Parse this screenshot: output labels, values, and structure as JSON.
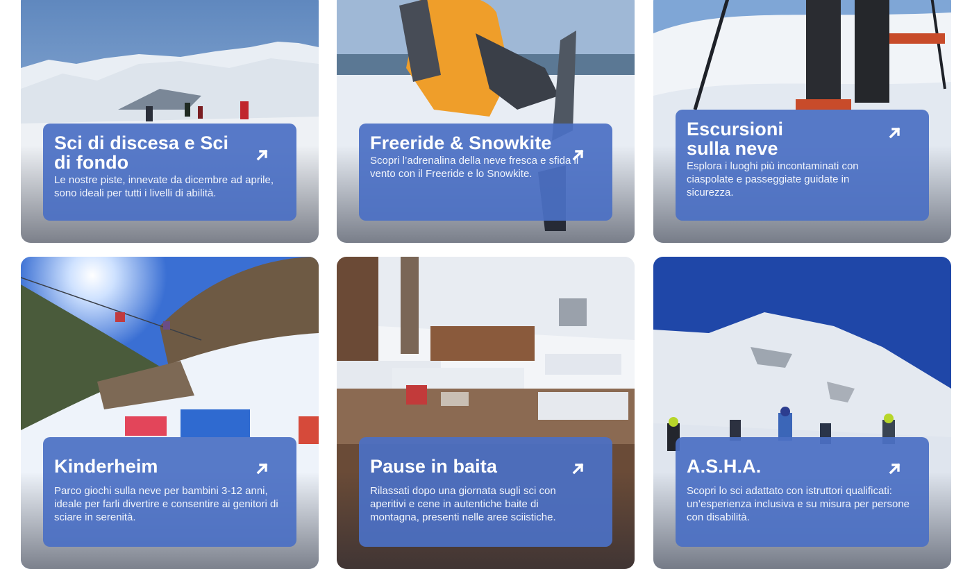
{
  "cards": [
    {
      "title": "Sci di discesa e Sci di fondo",
      "description": "Le nostre piste, innevate da dicembre ad aprile, sono ideali per tutti i livelli di abilità.",
      "arrow_icon": "arrow-up-right-icon"
    },
    {
      "title": "Freeride & Snowkite",
      "description": "Scopri l’adrenalina della neve fresca e sfida il vento con il Freeride e lo Snowkite.",
      "arrow_icon": "arrow-up-right-icon"
    },
    {
      "title": "Escursioni sulla neve",
      "description": "Esplora i luoghi più incontaminati con ciaspolate e passeggiate guidate in sicurezza.",
      "arrow_icon": "arrow-up-right-icon"
    },
    {
      "title": "Kinderheim",
      "description": "Parco giochi sulla neve per bambini 3-12 anni, ideale per farli divertire e consentire ai genitori di sciare in serenità.",
      "arrow_icon": "arrow-up-right-icon"
    },
    {
      "title": "Pause in baita",
      "description": "Rilassati dopo una giornata sugli sci con aperitivi e cene in autentiche baite di montagna, presenti nelle aree sciistiche.",
      "arrow_icon": "arrow-up-right-icon"
    },
    {
      "title": "A.S.H.A.",
      "description": "Scopri lo sci adattato con istruttori qualificati: un’esperienza inclusiva e su misura per persone con disabilità.",
      "arrow_icon": "arrow-up-right-icon"
    }
  ],
  "colors": {
    "panel": "#4b70c4",
    "text": "#ffffff"
  }
}
